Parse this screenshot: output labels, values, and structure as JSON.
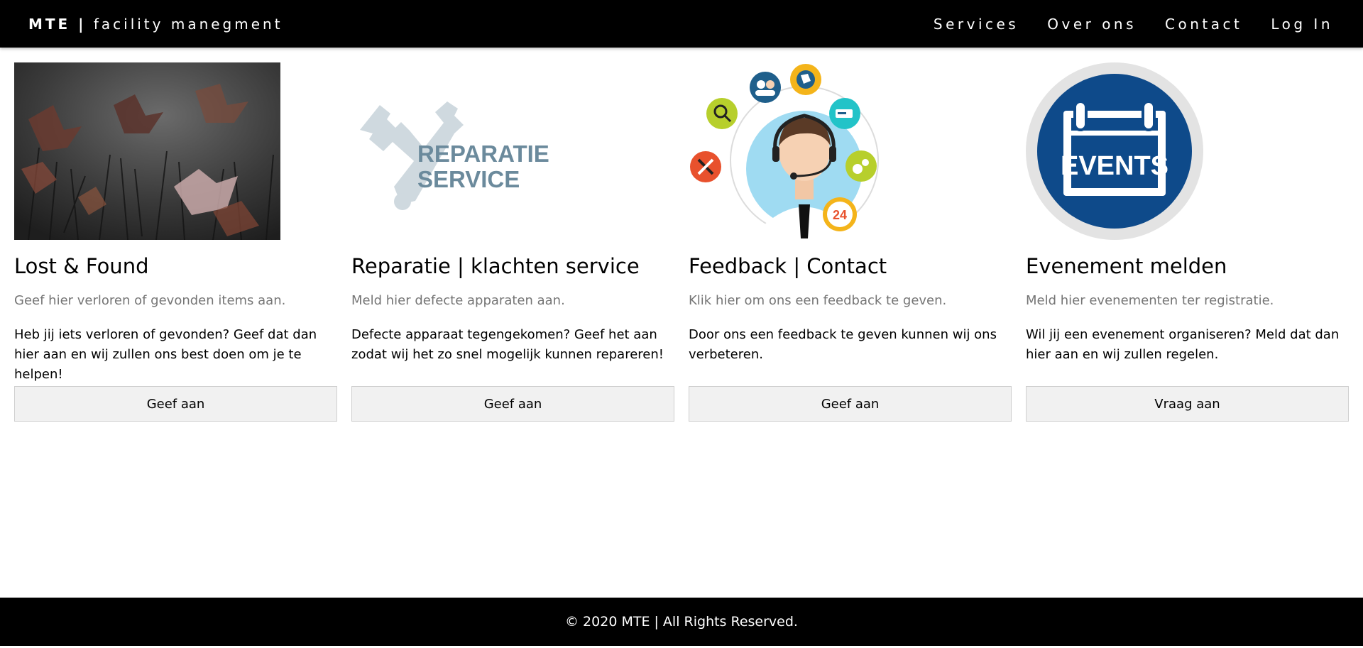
{
  "header": {
    "brand_bold": "MTE |",
    "brand_rest": "facility manegment",
    "nav": [
      {
        "label": "Services"
      },
      {
        "label": "Over ons"
      },
      {
        "label": "Contact"
      },
      {
        "label": "Log In"
      }
    ]
  },
  "cards": [
    {
      "title": "Lost & Found",
      "subtitle": "Geef hier verloren of gevonden items aan.",
      "text": "Heb jij iets verloren of gevonden? Geef dat dan hier aan en wij zullen ons best doen om je te helpen!",
      "button": "Geef aan",
      "image": "autumn-leaves-photo"
    },
    {
      "title": "Reparatie | klachten service",
      "subtitle": "Meld hier defecte apparaten aan.",
      "text": "Defecte apparaat tegengekomen? Geef het aan zodat wij het zo snel mogelijk kunnen repareren!",
      "button": "Geef aan",
      "image": "repair-service-logo",
      "image_text_1": "REPARATIE",
      "image_text_2": "SERVICE"
    },
    {
      "title": "Feedback | Contact",
      "subtitle": "Klik hier om ons een feedback te geven.",
      "text": "Door ons een feedback te geven kunnen wij ons verbeteren.",
      "button": "Geef aan",
      "image": "support-agent-illustration",
      "image_badge": "24"
    },
    {
      "title": "Evenement melden",
      "subtitle": "Meld hier evenementen ter registratie.",
      "text": "Wil jij een evenement organiseren? Meld dat dan hier aan en wij zullen regelen.",
      "button": "Vraag aan",
      "image": "events-calendar-icon",
      "image_text": "EVENTS"
    }
  ],
  "footer": {
    "text": "© 2020 MTE | All Rights Reserved."
  },
  "colors": {
    "header_bg": "#000000",
    "button_bg": "#f1f1f1",
    "subtitle": "#757575",
    "repair_text": "#6b8a9c",
    "events_blue": "#0e4a8a"
  }
}
